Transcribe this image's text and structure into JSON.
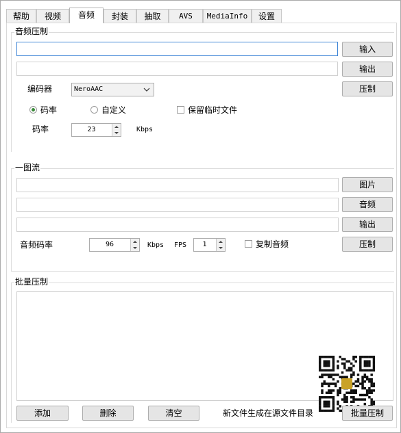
{
  "tabs": [
    {
      "label": "帮助"
    },
    {
      "label": "视频"
    },
    {
      "label": "音频"
    },
    {
      "label": "封装"
    },
    {
      "label": "抽取"
    },
    {
      "label": "AVS"
    },
    {
      "label": "MediaInfo"
    },
    {
      "label": "设置"
    }
  ],
  "audio_compress": {
    "group_label": "音频压制",
    "input_button": "输入",
    "output_button": "输出",
    "encoder_label": "编码器",
    "encoder_value": "NeroAAC",
    "compress_button": "压制",
    "radio_bitrate": "码率",
    "radio_custom": "自定义",
    "keep_temp": "保留临时文件",
    "bitrate_label": "码率",
    "bitrate_value": "23",
    "bitrate_unit": "Kbps"
  },
  "one_image": {
    "group_label": "一图流",
    "image_button": "图片",
    "audio_button": "音频",
    "output_button": "输出",
    "audio_bitrate_label": "音频码率",
    "audio_bitrate_value": "96",
    "audio_bitrate_unit": "Kbps",
    "fps_label": "FPS",
    "fps_value": "1",
    "copy_audio": "复制音频",
    "compress_button": "压制"
  },
  "batch": {
    "group_label": "批量压制",
    "add_button": "添加",
    "delete_button": "删除",
    "clear_button": "清空",
    "note": "新文件生成在源文件目录",
    "batch_button": "批量压制"
  },
  "colors": {
    "focus_border": "#3f86d6",
    "radio_dot": "#3a8a3a"
  }
}
